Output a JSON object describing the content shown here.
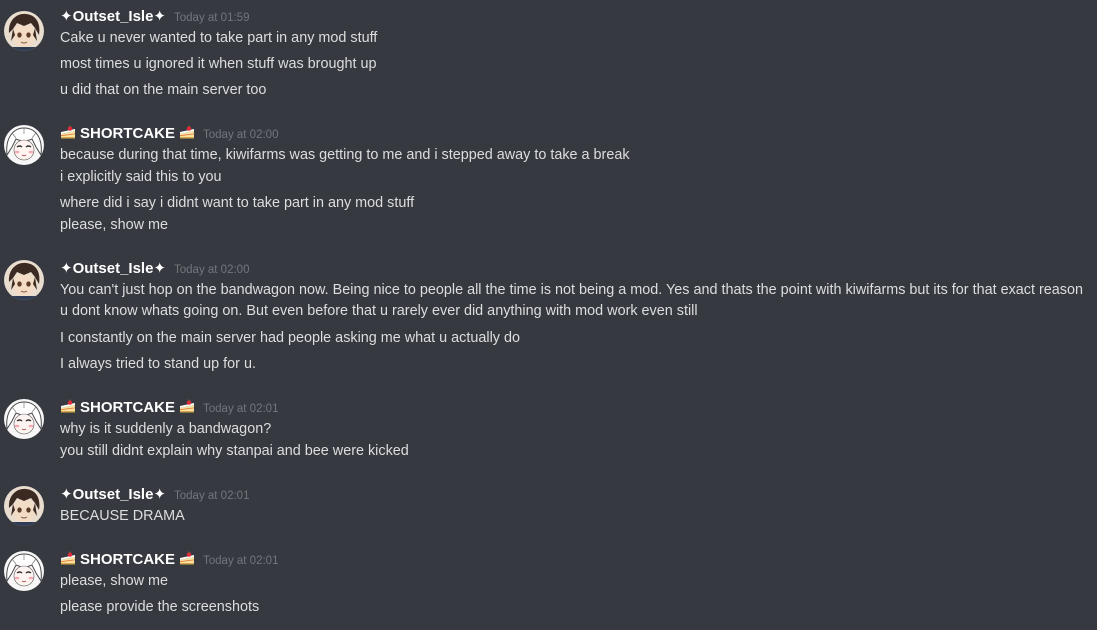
{
  "colors": {
    "background": "#36393f",
    "username": "#ffffff",
    "timestamp": "#72767d",
    "message_text": "#dcddde"
  },
  "messages": [
    {
      "author": "✦Outset_Isle✦",
      "avatar_icon": "dark-haired-anime-boy-avatar",
      "timestamp": "Today at 01:59",
      "lines": [
        "Cake u never wanted to take part in any mod stuff",
        "most times u ignored it when stuff was brought up",
        "u did that on the main server too"
      ]
    },
    {
      "author": "SHORTCAKE",
      "author_icons": [
        "shortcake-emoji-icon",
        "shortcake-emoji-icon"
      ],
      "avatar_icon": "white-haired-anime-avatar",
      "timestamp": "Today at 02:00",
      "lines": [
        "because during that time, kiwifarms was getting to me and i stepped away to take a break",
        "i explicitly said this to you",
        "where did i say i didnt want to take part in any mod stuff",
        "please, show me"
      ]
    },
    {
      "author": "✦Outset_Isle✦",
      "avatar_icon": "dark-haired-anime-boy-avatar",
      "timestamp": "Today at 02:00",
      "lines": [
        "You can't just hop on the bandwagon now. Being nice to people all the time is not being a mod. Yes and thats the point with kiwifarms but its for that exact reason u dont know whats going on. But even before that u rarely ever did anything with mod work even still",
        "I constantly on the main server had people asking me what u actually do",
        "I always tried to stand up for u."
      ]
    },
    {
      "author": "SHORTCAKE",
      "author_icons": [
        "shortcake-emoji-icon",
        "shortcake-emoji-icon"
      ],
      "avatar_icon": "white-haired-anime-avatar",
      "timestamp": "Today at 02:01",
      "lines": [
        "why is it suddenly a bandwagon?",
        "you still didnt explain why stanpai and bee were kicked"
      ]
    },
    {
      "author": "✦Outset_Isle✦",
      "avatar_icon": "dark-haired-anime-boy-avatar",
      "timestamp": "Today at 02:01",
      "lines": [
        "BECAUSE DRAMA"
      ]
    },
    {
      "author": "SHORTCAKE",
      "author_icons": [
        "shortcake-emoji-icon",
        "shortcake-emoji-icon"
      ],
      "avatar_icon": "white-haired-anime-avatar",
      "timestamp": "Today at 02:01",
      "lines": [
        "please, show me",
        "please provide the screenshots"
      ]
    }
  ]
}
